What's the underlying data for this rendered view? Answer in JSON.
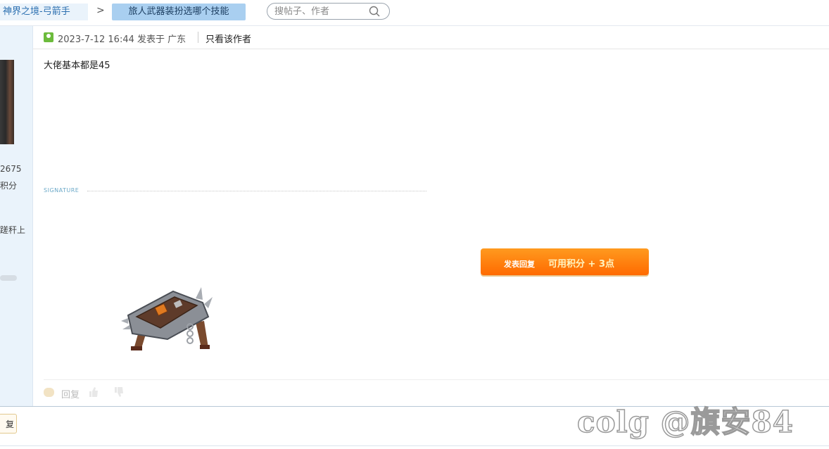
{
  "breadcrumb": {
    "forum": "神界之境-弓箭手",
    "separator": ">",
    "thread": "旅人武器装扮选哪个技能"
  },
  "search": {
    "placeholder": "搜帖子、作者"
  },
  "user_panel": {
    "number": "2675",
    "score_label": "积分",
    "text": "蹉秆上"
  },
  "post": {
    "time": "2023-7-12 16:44",
    "posted_in": "发表于",
    "location": "广东",
    "only_author": "只看该作者",
    "content": "大佬基本都是45",
    "signature_label": "SIGNATURE"
  },
  "reply_button": {
    "label": "发表回复",
    "bonus": "可用积分 + 3点"
  },
  "post_actions": {
    "reply": "回复"
  },
  "bottom": {
    "button_label": "复"
  },
  "watermark": "colg @旗安84"
}
